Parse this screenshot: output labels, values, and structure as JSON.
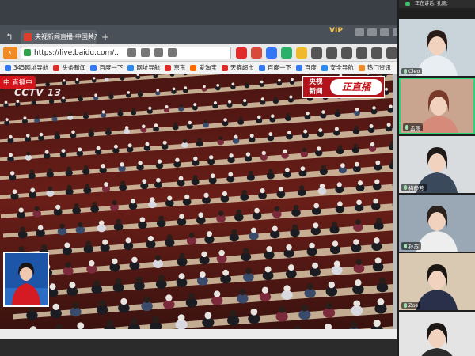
{
  "browser": {
    "tab_title": "央视新闻直播-中国共产",
    "tab_close": "×",
    "newtab": "+",
    "back": "↰",
    "vip": "VIP",
    "url": "https://live.baidu.com/..."
  },
  "bookmarks": [
    {
      "label": "345网址导航",
      "color": "#3478f6"
    },
    {
      "label": "头条新闻",
      "color": "#e02b2b"
    },
    {
      "label": "百度一下",
      "color": "#3478f6"
    },
    {
      "label": "网址导航",
      "color": "#2b8af0"
    },
    {
      "label": "京东",
      "color": "#e02b2b"
    },
    {
      "label": "爱淘宝",
      "color": "#ff6a00"
    },
    {
      "label": "天猫超市",
      "color": "#e02b2b"
    },
    {
      "label": "百度一下",
      "color": "#3478f6"
    },
    {
      "label": "百度",
      "color": "#3478f6"
    },
    {
      "label": "安全导航",
      "color": "#2b8af0"
    },
    {
      "label": "热门资讯",
      "color": "#f08a24"
    }
  ],
  "video": {
    "live_badge": "中 直播中",
    "channel_mark": "CCTV 13",
    "logo_left": "央视 新闻",
    "logo_right": "正直播"
  },
  "meeting": {
    "speaking_label": "正在讲话: 孔丽;",
    "participants": [
      {
        "name": "Cleo",
        "active": false,
        "bg": "#c9d3da",
        "hair": "#2a1c17",
        "shirt": "#e9eef2"
      },
      {
        "name": "孟丽",
        "active": true,
        "bg": "#c9a58f",
        "hair": "#7a3a2a",
        "shirt": "#d58a7a"
      },
      {
        "name": "梅静芳",
        "active": false,
        "bg": "#d8dcde",
        "hair": "#1f1a18",
        "shirt": "#3a4a5c"
      },
      {
        "name": "孙苏",
        "active": false,
        "bg": "#9aa8b5",
        "hair": "#2b211d",
        "shirt": "#eeeeee"
      },
      {
        "name": "Zoe",
        "active": false,
        "bg": "#d9c8b2",
        "hair": "#1c1715",
        "shirt": "#2a2f4a"
      },
      {
        "name": "",
        "active": false,
        "bg": "#e4e4e4",
        "hair": "#1c1715",
        "shirt": "#2c2c2c"
      }
    ]
  },
  "colors": {
    "accent_live": "#d4141b",
    "active_speaker": "#2fd27d"
  }
}
